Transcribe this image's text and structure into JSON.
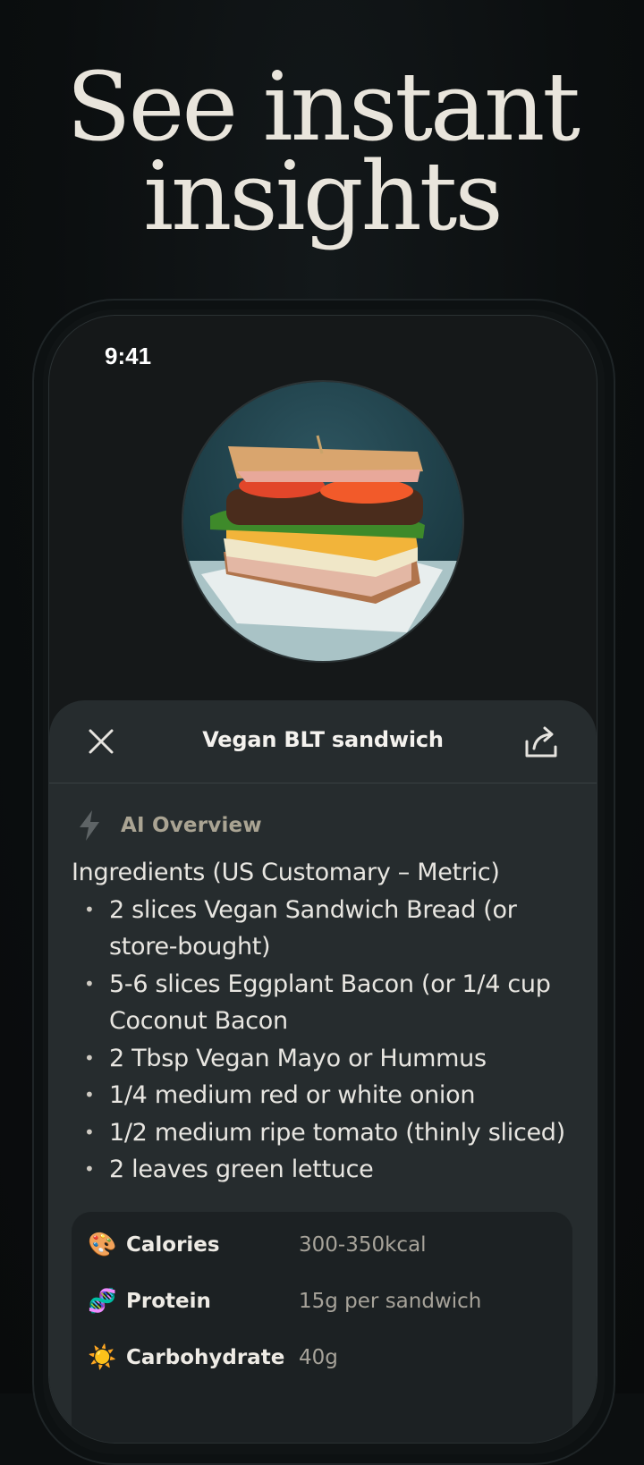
{
  "headline": {
    "line1": "See instant",
    "line2": "insights"
  },
  "status_bar": {
    "time": "9:41"
  },
  "sheet": {
    "title": "Vegan BLT sandwich",
    "overview_label": "AI Overview",
    "ingredients_heading": "Ingredients (US Customary – Metric)",
    "ingredients": [
      "2 slices Vegan Sandwich Bread (or store-bought)",
      "5-6 slices Eggplant Bacon (or 1/4 cup Coconut Bacon",
      "2 Tbsp Vegan Mayo or Hummus",
      "1/4 medium red or white onion",
      "1/2 medium ripe tomato (thinly sliced)",
      "2 leaves green lettuce"
    ],
    "nutrition": [
      {
        "icon": "palette-icon",
        "label": "Calories",
        "value": "300-350kcal"
      },
      {
        "icon": "dna-icon",
        "label": "Protein",
        "value": "15g per sandwich"
      },
      {
        "icon": "sun-icon",
        "label": "Carbohydrate",
        "value": "40g"
      }
    ]
  },
  "colors": {
    "background": "#0c0f10",
    "sheet": "#262c2e",
    "nutrition_card": "#1c2123",
    "accent_muted": "#aaa493"
  }
}
